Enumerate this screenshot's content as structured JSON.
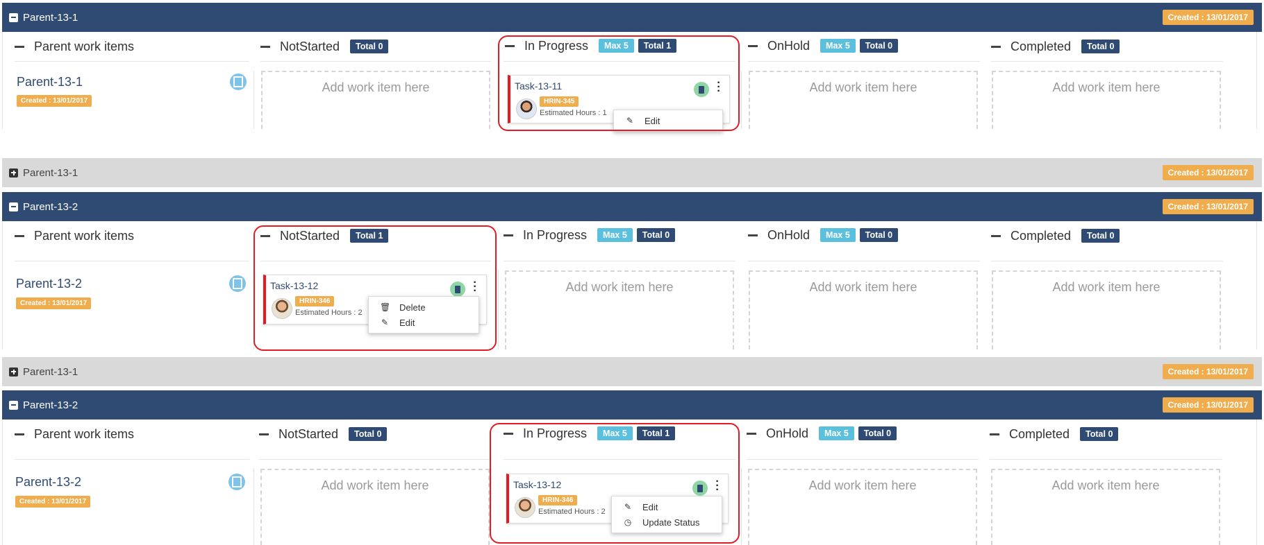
{
  "colors": {
    "header_dark": "#2f4a73",
    "header_light": "#d9d9d9",
    "created": "#f0ad4e",
    "max": "#5bc0de",
    "total": "#2f4a73",
    "highlight": "#e31b23",
    "card_border": "#e31b23"
  },
  "icons": {
    "expand": "minus-square-icon",
    "collapse": "plus-square-icon",
    "board": "board-icon",
    "book": "book-icon",
    "kebab": "kebab-menu-icon",
    "edit": "edit-icon",
    "delete": "trash-icon",
    "status": "clock-icon"
  },
  "headers": [
    {
      "title": "Parent-13-1",
      "created": "Created : 13/01/2017"
    },
    {
      "title": "Parent-13-1",
      "created": "Created : 13/01/2017"
    },
    {
      "title": "Parent-13-2",
      "created": "Created : 13/01/2017"
    },
    {
      "title": "Parent-13-1",
      "created": "Created : 13/01/2017"
    },
    {
      "title": "Parent-13-2",
      "created": "Created : 13/01/2017"
    }
  ],
  "boards": [
    {
      "columns": {
        "parent": "Parent work items",
        "notstarted": "NotStarted",
        "inprogress": "In Progress",
        "onhold": "OnHold",
        "completed": "Completed"
      },
      "badges": {
        "notstarted_total": "Total 0",
        "inprogress_max": "Max 5",
        "inprogress_total": "Total 1",
        "onhold_max": "Max 5",
        "onhold_total": "Total 0",
        "completed_total": "Total 0"
      },
      "parent": {
        "name": "Parent-13-1",
        "created": "Created : 13/01/2017"
      },
      "placeholder": "Add work item here",
      "card": {
        "title": "Task-13-11",
        "code": "HRIN-345",
        "estimated": "Estimated Hours : 1"
      },
      "menu": [
        "Edit"
      ]
    },
    {
      "columns": {
        "parent": "Parent work items",
        "notstarted": "NotStarted",
        "inprogress": "In Progress",
        "onhold": "OnHold",
        "completed": "Completed"
      },
      "badges": {
        "notstarted_total": "Total 1",
        "inprogress_max": "Max 5",
        "inprogress_total": "Total 0",
        "onhold_max": "Max 5",
        "onhold_total": "Total 0",
        "completed_total": "Total 0"
      },
      "parent": {
        "name": "Parent-13-2",
        "created": "Created : 13/01/2017"
      },
      "placeholder": "Add work item here",
      "card": {
        "title": "Task-13-12",
        "code": "HRIN-346",
        "estimated": "Estimated Hours : 2"
      },
      "menu": [
        "Delete",
        "Edit"
      ]
    },
    {
      "columns": {
        "parent": "Parent work items",
        "notstarted": "NotStarted",
        "inprogress": "In Progress",
        "onhold": "OnHold",
        "completed": "Completed"
      },
      "badges": {
        "notstarted_total": "Total 0",
        "inprogress_max": "Max 5",
        "inprogress_total": "Total 1",
        "onhold_max": "Max 5",
        "onhold_total": "Total 0",
        "completed_total": "Total 0"
      },
      "parent": {
        "name": "Parent-13-2",
        "created": "Created : 13/01/2017"
      },
      "placeholder": "Add work item here",
      "card": {
        "title": "Task-13-12",
        "code": "HRIN-346",
        "estimated": "Estimated Hours : 2"
      },
      "menu": [
        "Edit",
        "Update Status"
      ]
    }
  ]
}
